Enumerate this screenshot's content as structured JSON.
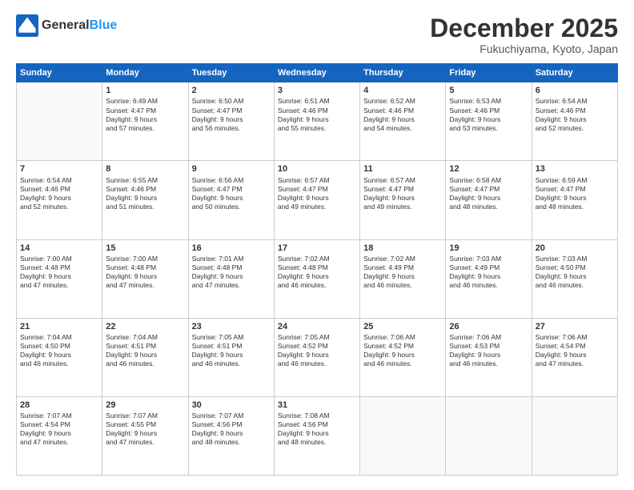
{
  "header": {
    "logo_general": "General",
    "logo_blue": "Blue",
    "month": "December 2025",
    "location": "Fukuchiyama, Kyoto, Japan"
  },
  "days_of_week": [
    "Sunday",
    "Monday",
    "Tuesday",
    "Wednesday",
    "Thursday",
    "Friday",
    "Saturday"
  ],
  "weeks": [
    [
      {
        "day": "",
        "info": ""
      },
      {
        "day": "1",
        "info": "Sunrise: 6:49 AM\nSunset: 4:47 PM\nDaylight: 9 hours\nand 57 minutes."
      },
      {
        "day": "2",
        "info": "Sunrise: 6:50 AM\nSunset: 4:47 PM\nDaylight: 9 hours\nand 56 minutes."
      },
      {
        "day": "3",
        "info": "Sunrise: 6:51 AM\nSunset: 4:46 PM\nDaylight: 9 hours\nand 55 minutes."
      },
      {
        "day": "4",
        "info": "Sunrise: 6:52 AM\nSunset: 4:46 PM\nDaylight: 9 hours\nand 54 minutes."
      },
      {
        "day": "5",
        "info": "Sunrise: 6:53 AM\nSunset: 4:46 PM\nDaylight: 9 hours\nand 53 minutes."
      },
      {
        "day": "6",
        "info": "Sunrise: 6:54 AM\nSunset: 4:46 PM\nDaylight: 9 hours\nand 52 minutes."
      }
    ],
    [
      {
        "day": "7",
        "info": "Sunrise: 6:54 AM\nSunset: 4:46 PM\nDaylight: 9 hours\nand 52 minutes."
      },
      {
        "day": "8",
        "info": "Sunrise: 6:55 AM\nSunset: 4:46 PM\nDaylight: 9 hours\nand 51 minutes."
      },
      {
        "day": "9",
        "info": "Sunrise: 6:56 AM\nSunset: 4:47 PM\nDaylight: 9 hours\nand 50 minutes."
      },
      {
        "day": "10",
        "info": "Sunrise: 6:57 AM\nSunset: 4:47 PM\nDaylight: 9 hours\nand 49 minutes."
      },
      {
        "day": "11",
        "info": "Sunrise: 6:57 AM\nSunset: 4:47 PM\nDaylight: 9 hours\nand 49 minutes."
      },
      {
        "day": "12",
        "info": "Sunrise: 6:58 AM\nSunset: 4:47 PM\nDaylight: 9 hours\nand 48 minutes."
      },
      {
        "day": "13",
        "info": "Sunrise: 6:59 AM\nSunset: 4:47 PM\nDaylight: 9 hours\nand 48 minutes."
      }
    ],
    [
      {
        "day": "14",
        "info": "Sunrise: 7:00 AM\nSunset: 4:48 PM\nDaylight: 9 hours\nand 47 minutes."
      },
      {
        "day": "15",
        "info": "Sunrise: 7:00 AM\nSunset: 4:48 PM\nDaylight: 9 hours\nand 47 minutes."
      },
      {
        "day": "16",
        "info": "Sunrise: 7:01 AM\nSunset: 4:48 PM\nDaylight: 9 hours\nand 47 minutes."
      },
      {
        "day": "17",
        "info": "Sunrise: 7:02 AM\nSunset: 4:48 PM\nDaylight: 9 hours\nand 46 minutes."
      },
      {
        "day": "18",
        "info": "Sunrise: 7:02 AM\nSunset: 4:49 PM\nDaylight: 9 hours\nand 46 minutes."
      },
      {
        "day": "19",
        "info": "Sunrise: 7:03 AM\nSunset: 4:49 PM\nDaylight: 9 hours\nand 46 minutes."
      },
      {
        "day": "20",
        "info": "Sunrise: 7:03 AM\nSunset: 4:50 PM\nDaylight: 9 hours\nand 46 minutes."
      }
    ],
    [
      {
        "day": "21",
        "info": "Sunrise: 7:04 AM\nSunset: 4:50 PM\nDaylight: 9 hours\nand 46 minutes."
      },
      {
        "day": "22",
        "info": "Sunrise: 7:04 AM\nSunset: 4:51 PM\nDaylight: 9 hours\nand 46 minutes."
      },
      {
        "day": "23",
        "info": "Sunrise: 7:05 AM\nSunset: 4:51 PM\nDaylight: 9 hours\nand 46 minutes."
      },
      {
        "day": "24",
        "info": "Sunrise: 7:05 AM\nSunset: 4:52 PM\nDaylight: 9 hours\nand 46 minutes."
      },
      {
        "day": "25",
        "info": "Sunrise: 7:06 AM\nSunset: 4:52 PM\nDaylight: 9 hours\nand 46 minutes."
      },
      {
        "day": "26",
        "info": "Sunrise: 7:06 AM\nSunset: 4:53 PM\nDaylight: 9 hours\nand 46 minutes."
      },
      {
        "day": "27",
        "info": "Sunrise: 7:06 AM\nSunset: 4:54 PM\nDaylight: 9 hours\nand 47 minutes."
      }
    ],
    [
      {
        "day": "28",
        "info": "Sunrise: 7:07 AM\nSunset: 4:54 PM\nDaylight: 9 hours\nand 47 minutes."
      },
      {
        "day": "29",
        "info": "Sunrise: 7:07 AM\nSunset: 4:55 PM\nDaylight: 9 hours\nand 47 minutes."
      },
      {
        "day": "30",
        "info": "Sunrise: 7:07 AM\nSunset: 4:56 PM\nDaylight: 9 hours\nand 48 minutes."
      },
      {
        "day": "31",
        "info": "Sunrise: 7:08 AM\nSunset: 4:56 PM\nDaylight: 9 hours\nand 48 minutes."
      },
      {
        "day": "",
        "info": ""
      },
      {
        "day": "",
        "info": ""
      },
      {
        "day": "",
        "info": ""
      }
    ]
  ]
}
